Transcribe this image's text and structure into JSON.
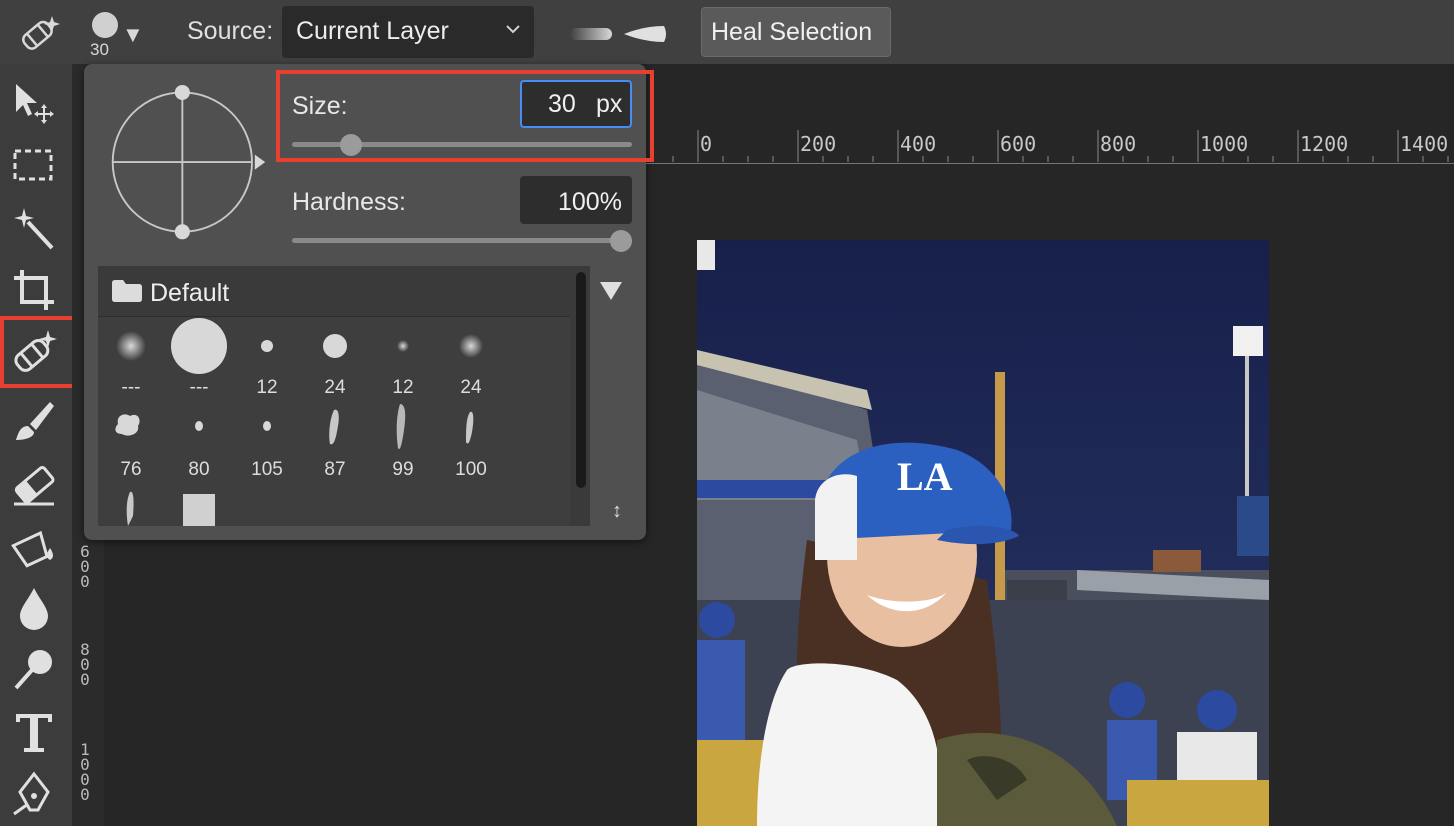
{
  "options_bar": {
    "brush_size": "30",
    "source_label": "Source:",
    "source_value": "Current Layer",
    "heal_button": "Heal Selection"
  },
  "brush_popup": {
    "size_label": "Size:",
    "size_value": "30",
    "size_unit": "px",
    "size_slider_fraction": 0.15,
    "hardness_label": "Hardness:",
    "hardness_value": "100%",
    "hardness_slider_fraction": 1.0,
    "preset_folder": "Default",
    "presets_row1": [
      "---",
      "---",
      "12",
      "24",
      "12",
      "24"
    ],
    "presets_row2": [
      "76",
      "80",
      "105",
      "87",
      "99",
      "100"
    ]
  },
  "rulers": {
    "horizontal": [
      "0",
      "200",
      "400",
      "600",
      "800",
      "1000",
      "1200",
      "1400"
    ],
    "vertical_visible": [
      "600",
      "800",
      "1000"
    ]
  },
  "toolbar": {
    "tools": [
      "move-tool",
      "marquee-tool",
      "magic-wand-tool",
      "crop-tool",
      "healing-brush-tool",
      "brush-tool",
      "eraser-tool",
      "paint-bucket-tool",
      "blur-tool",
      "dodge-tool",
      "text-tool",
      "pen-tool"
    ],
    "active_tool": "healing-brush-tool"
  },
  "colors": {
    "highlight": "#e8402f",
    "focus_border": "#4a8cf7"
  }
}
